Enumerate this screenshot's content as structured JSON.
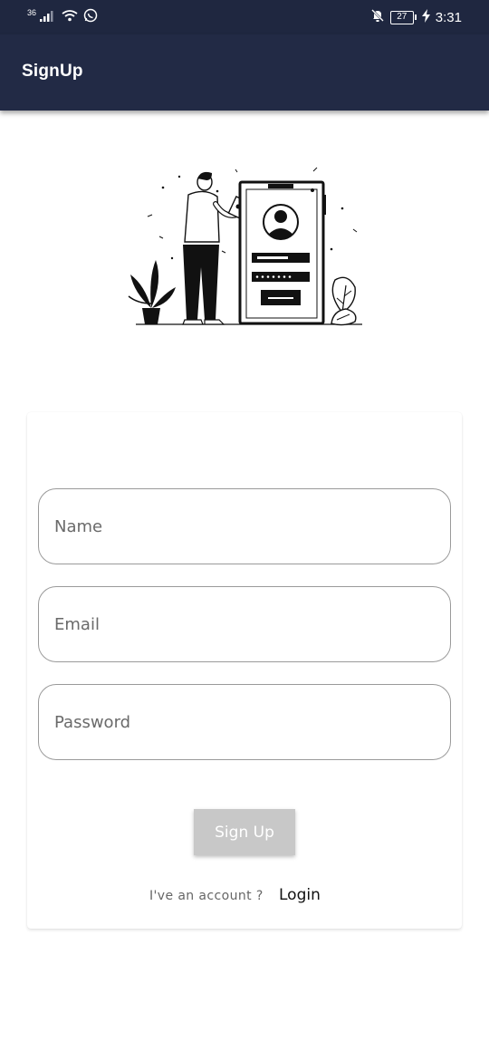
{
  "status_bar": {
    "network_label": "36",
    "signal_icon": "cellular-signal-icon",
    "wifi_icon": "wifi-icon",
    "whatsapp_icon": "whatsapp-icon",
    "mute_icon": "notifications-off-icon",
    "battery_level": "27",
    "charging_icon": "charging-bolt-icon",
    "time": "3:31"
  },
  "app_bar": {
    "title": "SignUp",
    "color": "#222a45"
  },
  "illustration": {
    "icon": "signup-illustration"
  },
  "form": {
    "name_placeholder": "Name",
    "email_placeholder": "Email",
    "password_placeholder": "Password",
    "signup_label": "Sign Up",
    "signup_color": "#c8c8c8"
  },
  "footer": {
    "account_text": "I've an account ?",
    "login_label": "Login"
  }
}
